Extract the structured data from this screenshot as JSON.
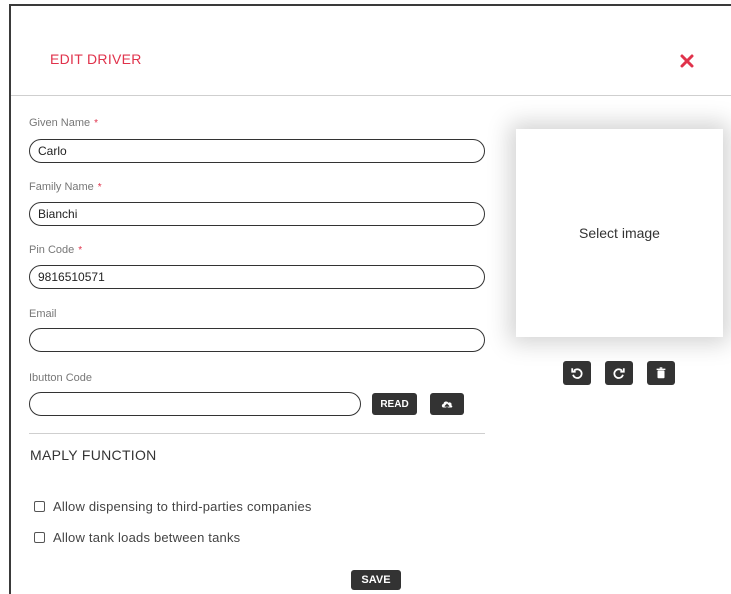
{
  "modal": {
    "title": "EDIT DRIVER",
    "close_icon": "close-x-icon",
    "accent_color": "#e0324b"
  },
  "form": {
    "given_name": {
      "label": "Given Name",
      "required_mark": "*",
      "value": "Carlo"
    },
    "family_name": {
      "label": "Family Name",
      "required_mark": "*",
      "value": "Bianchi"
    },
    "pin_code": {
      "label": "Pin Code",
      "required_mark": "*",
      "value": "9816510571"
    },
    "email": {
      "label": "Email",
      "value": ""
    },
    "ibutton_code": {
      "label": "Ibutton Code",
      "value": ""
    },
    "read_button": "READ",
    "upload_icon": "cloud-upload-icon"
  },
  "maply": {
    "title": "MAPLY FUNCTION",
    "options": [
      {
        "label": "Allow dispensing to third-parties companies",
        "checked": false
      },
      {
        "label": "Allow tank loads between tanks",
        "checked": false
      }
    ]
  },
  "image": {
    "placeholder": "Select image",
    "tools": [
      "rotate-left-icon",
      "rotate-right-icon",
      "trash-icon"
    ]
  },
  "footer": {
    "save_label": "SAVE"
  }
}
